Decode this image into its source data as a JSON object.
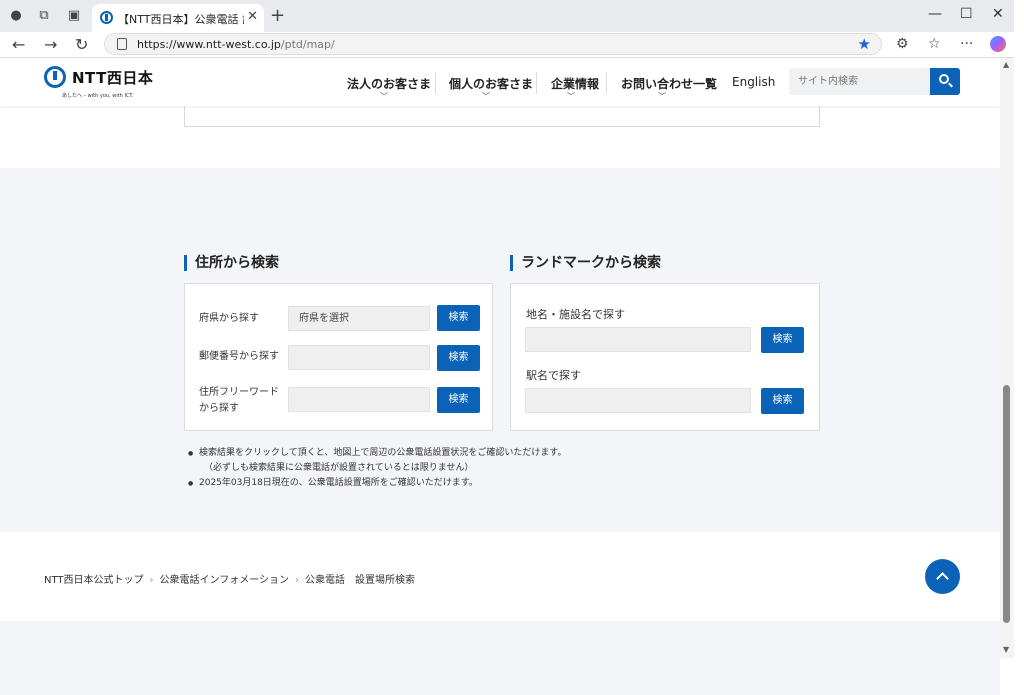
{
  "browser": {
    "tab_title": "【NTT西日本】公衆電話 設置場所検索",
    "url_host": "https://www.ntt-west.co.jp",
    "url_path": "/ptd/map/"
  },
  "header": {
    "logo_text": "NTT西日本",
    "logo_tagline": "あしたへ – with you, with ICT.",
    "nav": [
      {
        "label": "法人のお客さま"
      },
      {
        "label": "個人のお客さま"
      },
      {
        "label": "企業情報"
      },
      {
        "label": "お問い合わせ一覧"
      }
    ],
    "english_label": "English",
    "search_placeholder": "サイト内検索"
  },
  "address_search": {
    "title": "住所から検索",
    "rows": [
      {
        "label": "府県から探す",
        "value": "府県を選択",
        "button": "検索"
      },
      {
        "label": "郵便番号から探す",
        "value": "",
        "button": "検索"
      },
      {
        "label": "住所フリーワード\nから探す",
        "value": "",
        "button": "検索"
      }
    ]
  },
  "landmark_search": {
    "title": "ランドマークから検索",
    "rows": [
      {
        "label": "地名・施設名で探す",
        "button": "検索"
      },
      {
        "label": "駅名で探す",
        "button": "検索"
      }
    ]
  },
  "notes": {
    "note1": "検索結果をクリックして頂くと、地図上で周辺の公衆電話設置状況をご確認いただけます。",
    "note1_sub": "（必ずしも検索結果に公衆電話が設置されているとは限りません）",
    "note2": "2025年03月18日現在の、公衆電話設置場所をご確認いただけます。"
  },
  "breadcrumb": [
    "NTT西日本公式トップ",
    "公衆電話インフォメーション",
    "公衆電話　設置場所検索"
  ],
  "colors": {
    "accent": "#0a63b6",
    "band": "#f4f5f8"
  }
}
